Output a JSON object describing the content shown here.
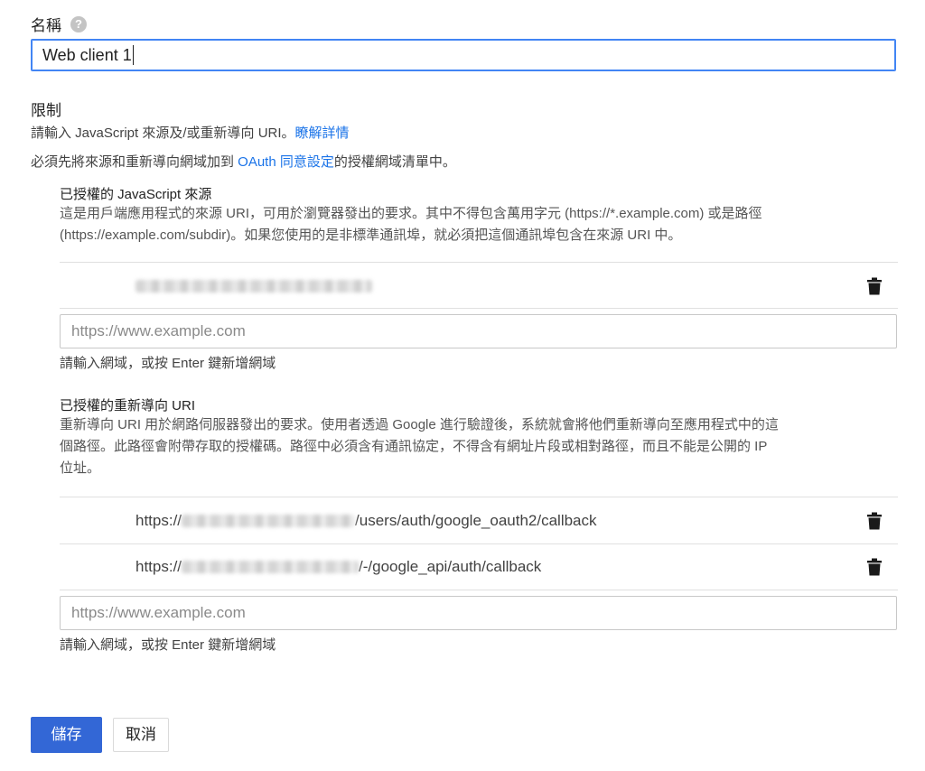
{
  "name_field": {
    "label": "名稱",
    "help_icon": "help-circle-icon",
    "value": "Web client 1"
  },
  "restrictions": {
    "title": "限制",
    "line1_prefix": "請輸入 JavaScript 來源及/或重新導向 URI。",
    "line1_link": "瞭解詳情",
    "line2_prefix": "必須先將來源和重新導向網域加到 ",
    "line2_link": "OAuth 同意設定",
    "line2_suffix": "的授權網域清單中。"
  },
  "js_origins": {
    "title": "已授權的 JavaScript 來源",
    "desc_line1": "這是用戶端應用程式的來源 URI，可用於瀏覽器發出的要求。其中不得包含萬用字元 (https://*.example.com) 或是路徑",
    "desc_line2": "(https://example.com/subdir)。如果您使用的是非標準通訊埠，就必須把這個通訊埠包含在來源 URI 中。",
    "items": [
      {
        "prefix": "",
        "suffix": "",
        "delete_icon": "trash-icon"
      }
    ],
    "input_placeholder": "https://www.example.com",
    "hint": "請輸入網域，或按 Enter 鍵新增網域"
  },
  "redirect_uris": {
    "title": "已授權的重新導向 URI",
    "desc_line1": "重新導向 URI 用於網路伺服器發出的要求。使用者透過 Google 進行驗證後，系統就會將他們重新導向至應用程式中的這",
    "desc_line2": "個路徑。此路徑會附帶存取的授權碼。路徑中必須含有通訊協定，不得含有網址片段或相對路徑，而且不能是公開的 IP",
    "desc_line3": "位址。",
    "items": [
      {
        "prefix": "https://",
        "suffix": "/users/auth/google_oauth2/callback",
        "delete_icon": "trash-icon"
      },
      {
        "prefix": "https://",
        "suffix": "/-/google_api/auth/callback",
        "delete_icon": "trash-icon"
      }
    ],
    "input_placeholder": "https://www.example.com",
    "hint": "請輸入網域，或按 Enter 鍵新增網域"
  },
  "buttons": {
    "save": "儲存",
    "cancel": "取消"
  },
  "colors": {
    "primary": "#3367d6",
    "link": "#1a73e8",
    "focus_border": "#4285f4"
  }
}
